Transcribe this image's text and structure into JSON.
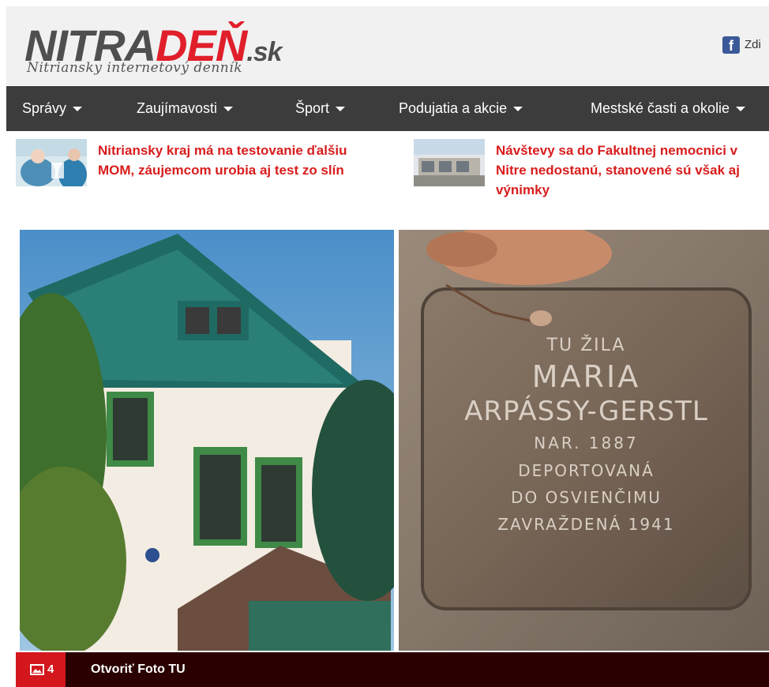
{
  "header": {
    "logo_nitra": "NITRA",
    "logo_den": "DEŇ",
    "logo_sk": ".sk",
    "tagline": "Nitriansky internetový denník",
    "social_text": "Zdi"
  },
  "nav": {
    "items": [
      {
        "label": "Správy"
      },
      {
        "label": "Zaujímavosti"
      },
      {
        "label": "Šport"
      },
      {
        "label": "Podujatia a akcie"
      },
      {
        "label": "Mestské časti a okolie"
      }
    ]
  },
  "teasers": [
    {
      "title": "Nitriansky kraj má na testovanie ďalšiu MOM, záujemcom urobia aj test zo slín"
    },
    {
      "title": "Návštevy sa do Fakultnej nemocnici v Nitre nedostanú, stanovené sú však aj výnimky"
    }
  ],
  "photo": {
    "stone_lines": [
      "TU ŽILA",
      "MARIA",
      "ARPÁSSY-GERSTL",
      "NAR. 1887",
      "DEPORTOVANÁ",
      "DO OSVIENČIMU",
      "ZAVRAŽDENÁ 1941"
    ]
  },
  "gallery_bar": {
    "count": "4",
    "label": "Otvoriť Foto TU"
  },
  "colors": {
    "brand_red": "#e01f2b",
    "nav_bg": "#3c3c3c",
    "headline_red": "#d81d1d"
  }
}
